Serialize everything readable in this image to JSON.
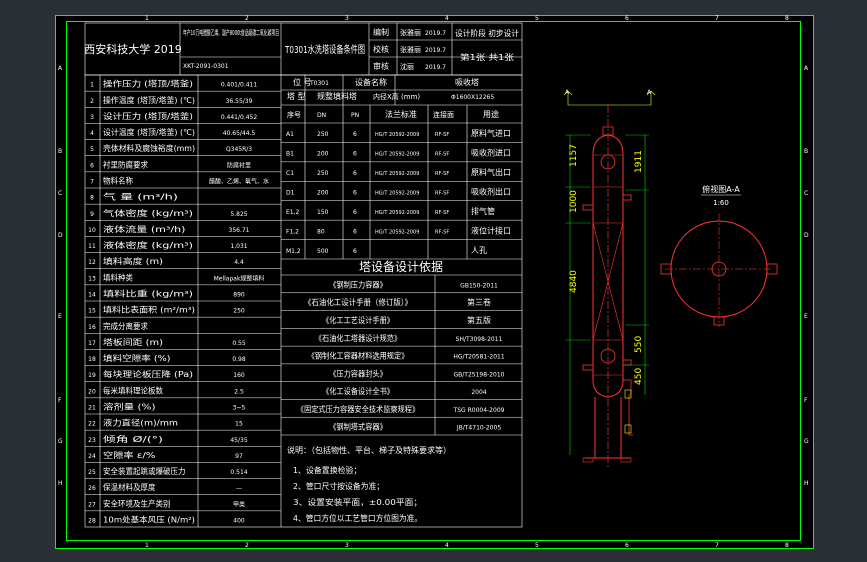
{
  "colors": {
    "background": "#000000",
    "border": "#00ff00",
    "text": "#ffffff",
    "vessel": "#ff3333",
    "annotation": "#ffff00",
    "centerline": "#ff4444",
    "dimension": "#00ff00"
  },
  "zone_letters": [
    "A",
    "B",
    "C",
    "D",
    "E",
    "F",
    "G",
    "H"
  ],
  "zone_numbers": [
    "1",
    "2",
    "3",
    "4",
    "5",
    "6",
    "7",
    "8"
  ],
  "title_block": {
    "school": "西安科技大学 2019",
    "project": "年产10万吨醋酸乙烯、副产8000t食品级碳二氧化碳项目",
    "drawing_no": "XKT-2091-0301",
    "drawing_name": "T0301水洗塔设备条件图",
    "designer_label": "编制",
    "designer": "张雅丽",
    "designer_date": "2019.7",
    "checker_label": "校核",
    "checker": "张雅丽",
    "checker_date": "2019.7",
    "approver_label": "审核",
    "approver": "沈丽",
    "approver_date": "2019.7",
    "stage": "设计阶段 初步设计",
    "sheet": "第1张 共1张"
  },
  "spec_rows": [
    {
      "no": "1",
      "name": "操作压力 (塔顶/塔釜)",
      "value": "0.401/0.411"
    },
    {
      "no": "2",
      "name": "操作温度 (塔顶/塔釜) (℃)",
      "value": "36.55/39"
    },
    {
      "no": "3",
      "name": "设计压力 (塔顶/塔釜)",
      "value": "0.441/0.452"
    },
    {
      "no": "4",
      "name": "设计温度 (塔顶/塔釜) (℃)",
      "value": "40.65/44.5"
    },
    {
      "no": "5",
      "name": "壳体材料及腐蚀裕度(mm)",
      "value": "Q345R/3"
    },
    {
      "no": "6",
      "name": "衬里防腐要求",
      "value": "防腐衬里"
    },
    {
      "no": "7",
      "name": "物料名称",
      "value": "醋酸、乙烯、氧气、水"
    },
    {
      "no": "8",
      "name": "气 量 (m³/h)",
      "value": ""
    },
    {
      "no": "9",
      "name": "气体密度 (kg/m³)",
      "value": "5.825"
    },
    {
      "no": "10",
      "name": "液体流量 (m³/h)",
      "value": "356.71"
    },
    {
      "no": "11",
      "name": "液体密度 (kg/m³)",
      "value": "1,031"
    },
    {
      "no": "12",
      "name": "填料高度 (m)",
      "value": "4.4"
    },
    {
      "no": "13",
      "name": "填料种类",
      "value": "Mellapak规整填料"
    },
    {
      "no": "14",
      "name": "填料比重 (kg/m³)",
      "value": "890"
    },
    {
      "no": "15",
      "name": "填料比表面积 (m²/m³)",
      "value": "250"
    },
    {
      "no": "16",
      "name": "完成分离要求",
      "value": ""
    },
    {
      "no": "17",
      "name": "塔板间距 (m)",
      "value": "0.55"
    },
    {
      "no": "18",
      "name": "填料空隙率 (%)",
      "value": "0.98"
    },
    {
      "no": "19",
      "name": "每块理论板压降 (Pa)",
      "value": "160"
    },
    {
      "no": "20",
      "name": "每米填料理论板数",
      "value": "2.5"
    },
    {
      "no": "21",
      "name": "溶剂量 (%)",
      "value": "3~5"
    },
    {
      "no": "22",
      "name": "液力直径(m)/mm",
      "value": "15"
    },
    {
      "no": "23",
      "name": "倾角 Ø/(°)",
      "value": "45/35"
    },
    {
      "no": "24",
      "name": "空隙率 ε/%",
      "value": "97"
    },
    {
      "no": "25",
      "name": "安全装置起跳或爆破压力",
      "value": "0.514"
    },
    {
      "no": "26",
      "name": "保温材料及厚度",
      "value": "—"
    },
    {
      "no": "27",
      "name": "安全环境及生产类别",
      "value": "甲类"
    },
    {
      "no": "28",
      "name": "10m处基本风压 (N/m²)",
      "value": "400"
    }
  ],
  "nozzle_header": {
    "no": "序号",
    "dn": "DN",
    "pn": "PN",
    "std": "法兰标准",
    "face": "连接面",
    "use": "用途"
  },
  "nozzle_top": {
    "label1": "位 号",
    "value1": "T0301",
    "label2": "设备名称",
    "value2": "吸收塔",
    "label3": "塔 型",
    "value3": "规整填料塔",
    "label4": "内径X高 (mm)",
    "value4": "Φ1600X12265"
  },
  "nozzles": [
    {
      "mark": "A1",
      "dn": "250",
      "pn": "6",
      "std": "HG/T 20592-2009",
      "face": "RF-SF",
      "use": "原料气进口"
    },
    {
      "mark": "B1",
      "dn": "200",
      "pn": "6",
      "std": "HG/T 20592-2009",
      "face": "RF-SF",
      "use": "吸收剂进口"
    },
    {
      "mark": "C1",
      "dn": "250",
      "pn": "6",
      "std": "HG/T 20592-2009",
      "face": "RF-SF",
      "use": "原料气出口"
    },
    {
      "mark": "D1",
      "dn": "200",
      "pn": "6",
      "std": "HG/T 20592-2009",
      "face": "RF-SF",
      "use": "吸收剂出口"
    },
    {
      "mark": "E1,2",
      "dn": "150",
      "pn": "6",
      "std": "HG/T 20592-2009",
      "face": "RF-SF",
      "use": "排气管"
    },
    {
      "mark": "F1,2",
      "dn": "80",
      "pn": "6",
      "std": "HG/T 20592-2009",
      "face": "RF-SF",
      "use": "液位计接口"
    },
    {
      "mark": "M1,2",
      "dn": "500",
      "pn": "6",
      "std": "",
      "face": "",
      "use": "人孔"
    }
  ],
  "basis_title": "塔设备设计依据",
  "basis_rows": [
    {
      "name": "《钢制压力容器》",
      "code": "GB150-2011",
      "extra": ""
    },
    {
      "name": "《石油化工设计手册（修订版）》",
      "code": "",
      "extra": "第三卷"
    },
    {
      "name": "《化工工艺设计手册》",
      "code": "",
      "extra": "第五版"
    },
    {
      "name": "《石油化工塔器设计规范》",
      "code": "SH/T3098-2011",
      "extra": ""
    },
    {
      "name": "《钢制化工容器材料选用规定》",
      "code": "HG/T20581-2011",
      "extra": ""
    },
    {
      "name": "《压力容器封头》",
      "code": "GB/T25198-2010",
      "extra": ""
    },
    {
      "name": "《化工设备设计全书》",
      "code": "2004",
      "extra": ""
    },
    {
      "name": "《固定式压力容器安全技术监察规程》",
      "code": "TSG R0004-2009",
      "extra": ""
    },
    {
      "name": "《钢制塔式容器》",
      "code": "JB/T4710-2005",
      "extra": ""
    }
  ],
  "notes_title": "说明：（包括物性、平台、梯子及特殊要求等）",
  "notes": [
    "1、设备置换检验；",
    "2、管口尺寸按设备为准；",
    "3、设置安装平面，±0.00平面；",
    "4、管口方位以工艺管口方位图为准。"
  ],
  "elevation_view": {
    "section_marker": "A",
    "dimensions": [
      "1157",
      "1911",
      "1000",
      "4840",
      "550",
      "450"
    ]
  },
  "section_view": {
    "title": "俯视图A-A",
    "scale": "1:60"
  }
}
